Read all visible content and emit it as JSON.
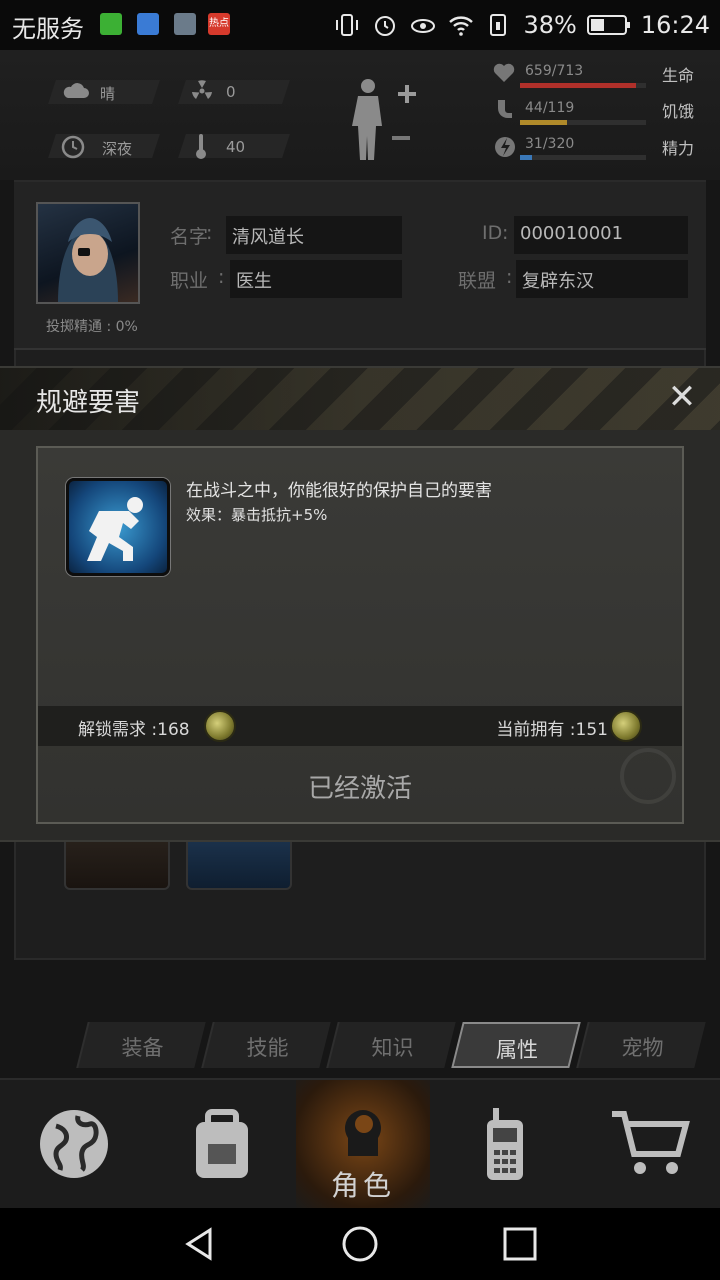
{
  "status_bar": {
    "carrier": "无服务",
    "apps": [
      {
        "name": "wechat-icon",
        "color": "#3cb034",
        "text": ""
      },
      {
        "name": "health-icon",
        "color": "#3a7bd5",
        "text": ""
      },
      {
        "name": "gallery-icon",
        "color": "#6b7b8a",
        "text": ""
      },
      {
        "name": "hotspot-news-icon",
        "color": "#d63a2c",
        "text": "热点"
      }
    ],
    "battery_percent": "38%",
    "time": "16:24"
  },
  "top_stats": {
    "weather": "晴",
    "radiation": "0",
    "time_of_day": "深夜",
    "temperature": "40",
    "bars": [
      {
        "label": "659/713",
        "name": "生命",
        "value": 0.924,
        "color": "#b0302a"
      },
      {
        "label": "44/119",
        "name": "饥饿",
        "value": 0.37,
        "color": "#b08a2a"
      },
      {
        "label": "31/320",
        "name": "精力",
        "value": 0.097,
        "color": "#3a78b8"
      }
    ]
  },
  "profile": {
    "name_label": "名字",
    "name_value": "清风道长",
    "id_label": "ID",
    "id_value": "000010001",
    "job_label": "职业",
    "job_value": "医生",
    "alliance_label": "联盟",
    "alliance_value": "复辟东汉",
    "skill_line": "投掷精通 : 0%"
  },
  "dialog": {
    "title": "规避要害",
    "close_symbol": "✕",
    "description": "在战斗之中，你能很好的保护自己的要害",
    "effect": "效果：暴击抵抗+5%",
    "unlock_label": "解锁需求 :",
    "unlock_value": "168",
    "owned_label": "当前拥有 :",
    "owned_value": "151",
    "status": "已经激活"
  },
  "tabs": [
    {
      "label": "装备",
      "active": false
    },
    {
      "label": "技能",
      "active": false
    },
    {
      "label": "知识",
      "active": false
    },
    {
      "label": "属性",
      "active": true
    },
    {
      "label": "宠物",
      "active": false
    }
  ],
  "bottom_nav": {
    "active_label": "角色"
  }
}
